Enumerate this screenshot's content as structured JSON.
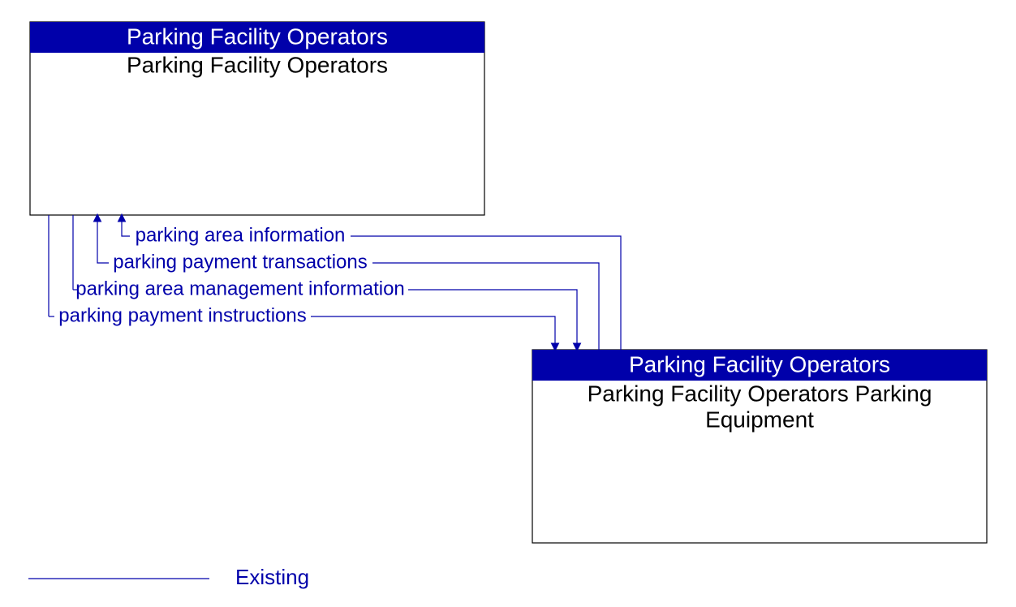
{
  "colors": {
    "header_bg": "#0000AA",
    "flow": "#0000AA",
    "body_bg": "#ffffff",
    "body_text": "#000000"
  },
  "boxes": {
    "top": {
      "header": "Parking Facility Operators",
      "title": "Parking Facility Operators"
    },
    "bottom": {
      "header": "Parking Facility Operators",
      "title_line1": "Parking Facility Operators Parking",
      "title_line2": "Equipment"
    }
  },
  "flows": {
    "f1": {
      "label": "parking area information",
      "direction": "bottom_to_top"
    },
    "f2": {
      "label": "parking payment transactions",
      "direction": "bottom_to_top"
    },
    "f3": {
      "label": "parking area management information",
      "direction": "top_to_bottom"
    },
    "f4": {
      "label": "parking payment instructions",
      "direction": "top_to_bottom"
    }
  },
  "legend": {
    "existing": "Existing"
  }
}
